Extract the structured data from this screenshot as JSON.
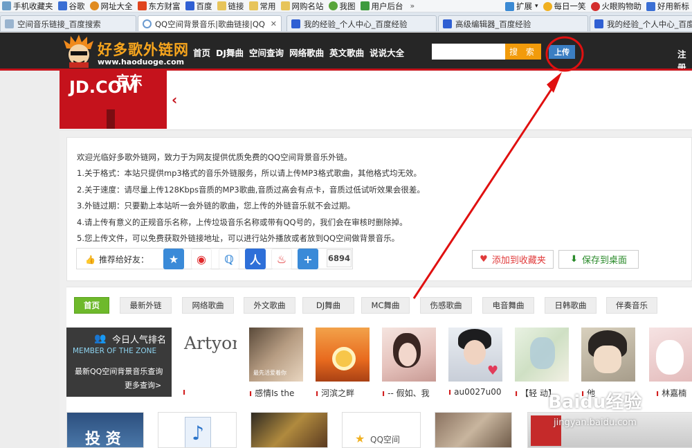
{
  "bookmarks": {
    "items": [
      {
        "label": "手机收藏夹",
        "color": "#6d9ec7"
      },
      {
        "label": "谷歌",
        "color": "#3b6fd4"
      },
      {
        "label": "网址大全",
        "color": "#e08a1e"
      },
      {
        "label": "东方财富",
        "color": "#e0451e"
      },
      {
        "label": "百度",
        "color": "#2f5fd3"
      },
      {
        "label": "链接",
        "color": "#e7c45a"
      },
      {
        "label": "常用",
        "color": "#e7c45a"
      },
      {
        "label": "网购名站",
        "color": "#e7c45a"
      },
      {
        "label": "我图",
        "color": "#58a53a"
      },
      {
        "label": "用户后台",
        "color": "#3e9b3e"
      }
    ],
    "more_chevron": "»",
    "right_items": [
      {
        "label": "扩展",
        "color": "#3b8ad4"
      },
      {
        "label": "每日一笑",
        "color": "#f0b020"
      },
      {
        "label": "火眼购物助",
        "color": "#d32d2d"
      },
      {
        "label": "好用新标",
        "color": "#3b6fd4"
      }
    ]
  },
  "tabs": [
    {
      "label": "空间音乐链接_百度搜索",
      "active": false
    },
    {
      "label": "QQ空间背景音乐|歌曲链接|QQ",
      "active": true
    },
    {
      "label": "我的经验_个人中心_百度经验",
      "active": false
    },
    {
      "label": "高级编辑器_百度经验",
      "active": false
    },
    {
      "label": "我的经验_个人中心_百度经验",
      "active": false
    }
  ],
  "site": {
    "logo_title": "好多歌外链网",
    "logo_url": "www.haoduoge.com",
    "nav": [
      "首页",
      "DJ舞曲",
      "空间查询",
      "网络歌曲",
      "英文歌曲",
      "说说大全"
    ],
    "search_button": "搜 索",
    "search_placeholder": "",
    "upload_button": "上传",
    "register_link": "注册"
  },
  "banner": {
    "brand_en": "JD.COM",
    "brand_cn": "京东",
    "prev_arrow": "‹"
  },
  "notice": {
    "lines": [
      "欢迎光临好多歌外链网，致力于为网友提供优质免费的QQ空间背景音乐外链。",
      "1.关于格式：本站只提供mp3格式的音乐外链服务，所以请上传MP3格式歌曲，其他格式均无效。",
      "2.关于速度：请尽量上传128Kbps音质的MP3歌曲,音质过高会有点卡，音质过低试听效果会很差。",
      "3.外链过期：只要勤上本站听一会外链的歌曲，您上传的外链音乐就不会过期。",
      "4.请上传有意义的正规音乐名称，上传垃圾音乐名称或带有QQ号的，我们会在审核时删除掉。",
      "5.您上传文件，可以免费获取外链接地址，可以进行站外播放或者放到QQ空间做背景音乐。"
    ]
  },
  "share": {
    "label": "推荐给好友：",
    "count": "6894",
    "add_favorite": "添加到收藏夹",
    "save_desktop": "保存到桌面"
  },
  "categories": [
    "首页",
    "最新外链",
    "网络歌曲",
    "外文歌曲",
    "DJ舞曲",
    "MC舞曲",
    "伤感歌曲",
    "电音舞曲",
    "日韩歌曲",
    "伴奏音乐"
  ],
  "rank_panel": {
    "title": "今日人气排名",
    "subtitle": "MEMBER OF THE ZONE",
    "desc": "最新QQ空间背景音乐查询",
    "more": "更多查询>"
  },
  "music_items": [
    {
      "caption": "",
      "thumb_text": "Artyom"
    },
    {
      "caption": "感情Is the",
      "thumb_text": "最先活爱着你"
    },
    {
      "caption": "河滨之畔",
      "thumb_text": ""
    },
    {
      "caption": "-- 假如、我",
      "thumb_text": ""
    },
    {
      "caption": "au0027u00",
      "thumb_text": ""
    },
    {
      "caption": "【轻 动】",
      "thumb_text": ""
    },
    {
      "caption": "他",
      "thumb_text": ""
    },
    {
      "caption": "林嘉楠",
      "thumb_text": ""
    }
  ],
  "bottom_tiles": [
    "投 资",
    "",
    "",
    "QQ空间",
    "",
    ""
  ],
  "watermark": {
    "brand": "Baidu经验",
    "url": "jingyan.baidu.com"
  },
  "colors": {
    "header_bg": "#262626",
    "accent_red": "#c6121a",
    "search_orange": "#f29b0b",
    "upload_blue": "#3b7ec2",
    "category_green": "#6eb92b"
  }
}
